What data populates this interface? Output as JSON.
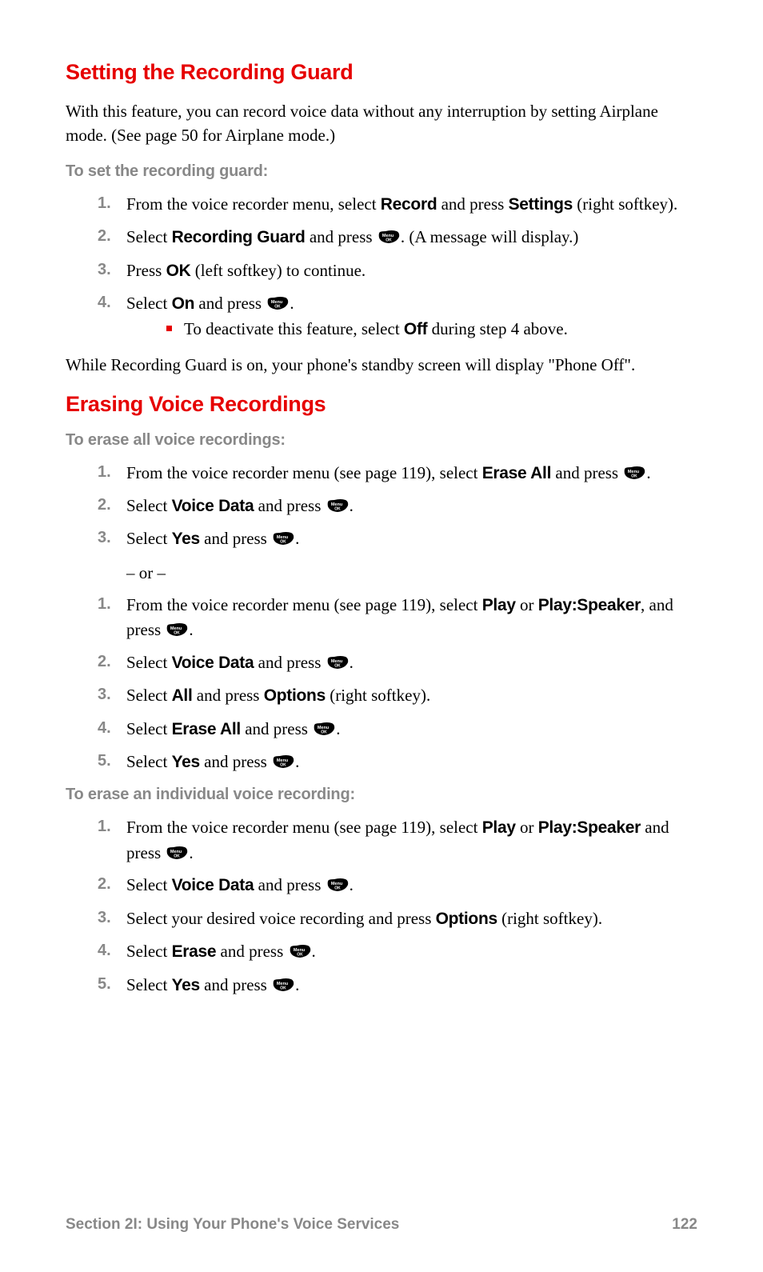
{
  "section1": {
    "title": "Setting the Recording Guard",
    "intro": "With this feature, you can record voice data without any interruption by setting Airplane mode. (See page 50 for Airplane mode.)",
    "sub": "To set the recording guard:",
    "s1a": "From the voice recorder menu, select ",
    "s1b": "Record",
    "s1c": " and press ",
    "s1d": "Settings",
    "s1e": " (right softkey).",
    "s2a": "Select ",
    "s2b": "Recording Guard",
    "s2c": " and press ",
    "s2d": ". (A message will display.)",
    "s3a": "Press ",
    "s3b": "OK",
    "s3c": " (left softkey) to continue.",
    "s4a": "Select ",
    "s4b": "On",
    "s4c": " and press ",
    "s4d": ".",
    "sub_bullet_a": "To deactivate this feature, select ",
    "sub_bullet_b": "Off",
    "sub_bullet_c": " during step 4 above.",
    "outro": "While Recording Guard is on, your phone's standby screen will display \"Phone Off\"."
  },
  "section2": {
    "title": "Erasing Voice Recordings",
    "sub1": "To erase all voice recordings:",
    "a1a": "From the voice recorder menu (see page 119), select ",
    "a1b": "Erase All",
    "a1c": " and press ",
    "a1d": ".",
    "a2a": "Select ",
    "a2b": "Voice Data",
    "a2c": " and press ",
    "a2d": ".",
    "a3a": "Select ",
    "a3b": "Yes",
    "a3c": " and press ",
    "a3d": ".",
    "or": "– or –",
    "b1a": "From the voice recorder menu (see page 119), select ",
    "b1b": "Play",
    "b1c": " or ",
    "b1d": "Play:Speaker",
    "b1e": ", and press ",
    "b1f": ".",
    "b2a": "Select ",
    "b2b": "Voice Data",
    "b2c": " and press ",
    "b2d": ".",
    "b3a": "Select ",
    "b3b": "All",
    "b3c": " and press ",
    "b3d": "Options",
    "b3e": " (right softkey).",
    "b4a": "Select ",
    "b4b": "Erase All",
    "b4c": " and press ",
    "b4d": ".",
    "b5a": "Select ",
    "b5b": "Yes",
    "b5c": " and press ",
    "b5d": ".",
    "sub2": "To erase an individual voice recording:",
    "c1a": "From the voice recorder menu (see page 119), select ",
    "c1b": "Play",
    "c1c": " or ",
    "c1d": "Play:Speaker",
    "c1e": " and press ",
    "c1f": ".",
    "c2a": "Select ",
    "c2b": "Voice Data",
    "c2c": " and press ",
    "c2d": ".",
    "c3a": "Select your desired voice recording and press ",
    "c3b": "Options",
    "c3c": " (right softkey).",
    "c4a": "Select ",
    "c4b": "Erase",
    "c4c": " and press ",
    "c4d": ".",
    "c5a": "Select ",
    "c5b": "Yes",
    "c5c": " and press ",
    "c5d": "."
  },
  "nums": {
    "1": "1.",
    "2": "2.",
    "3": "3.",
    "4": "4.",
    "5": "5."
  },
  "footer": {
    "left": "Section 2I: Using Your Phone's Voice Services",
    "right": "122"
  }
}
